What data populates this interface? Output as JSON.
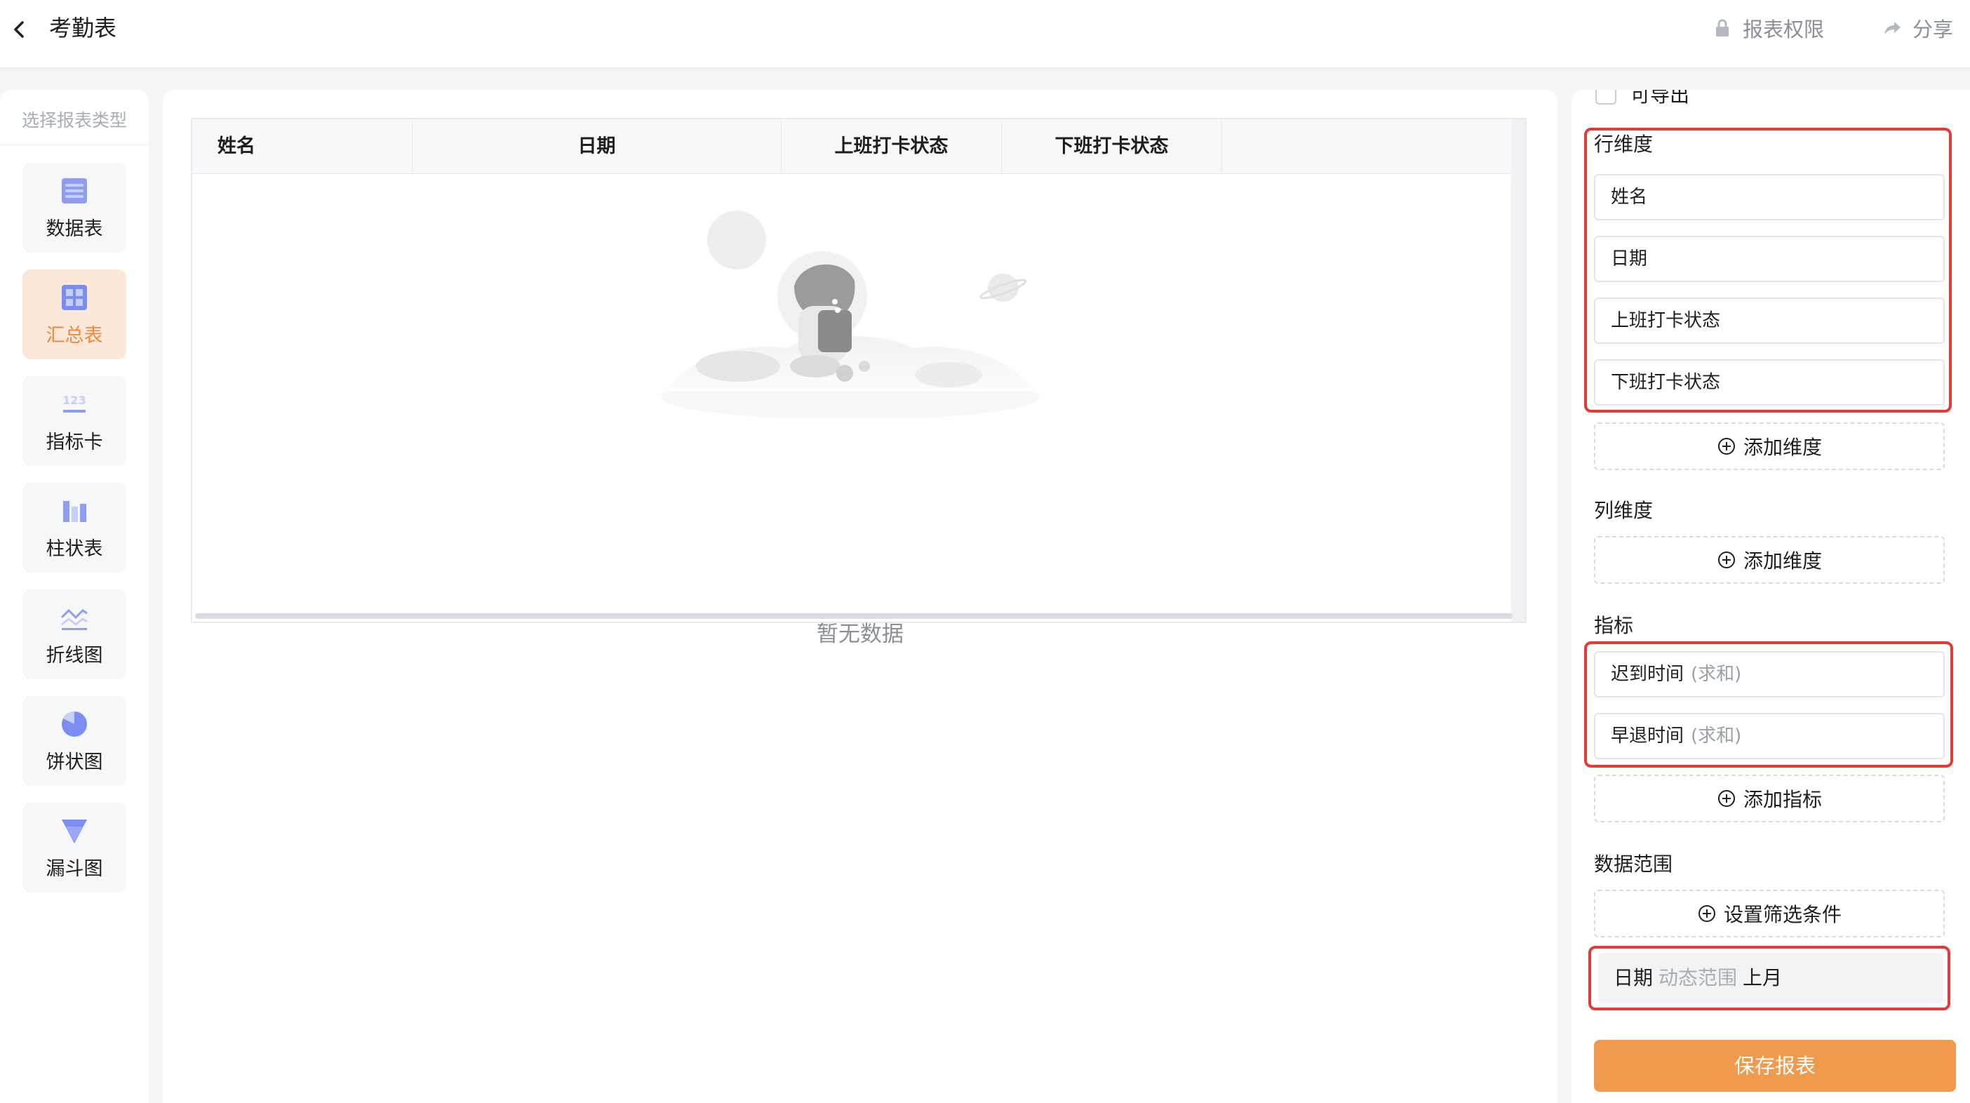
{
  "header": {
    "title": "考勤表",
    "permission_label": "报表权限",
    "share_label": "分享"
  },
  "sidebar": {
    "title": "选择报表类型",
    "items": [
      {
        "label": "数据表",
        "icon": "table-icon"
      },
      {
        "label": "汇总表",
        "icon": "summary-table-icon",
        "active": true
      },
      {
        "label": "指标卡",
        "icon": "metric-card-icon"
      },
      {
        "label": "柱状表",
        "icon": "bar-chart-icon"
      },
      {
        "label": "折线图",
        "icon": "line-chart-icon"
      },
      {
        "label": "饼状图",
        "icon": "pie-chart-icon"
      },
      {
        "label": "漏斗图",
        "icon": "funnel-chart-icon"
      }
    ]
  },
  "table": {
    "columns": [
      "姓名",
      "日期",
      "上班打卡状态",
      "下班打卡状态"
    ],
    "empty_text": "暂无数据"
  },
  "config": {
    "exportable_label": "可导出",
    "row_dimension": {
      "label": "行维度",
      "fields": [
        "姓名",
        "日期",
        "上班打卡状态",
        "下班打卡状态"
      ],
      "add_label": "添加维度"
    },
    "column_dimension": {
      "label": "列维度",
      "add_label": "添加维度"
    },
    "metrics": {
      "label": "指标",
      "fields": [
        {
          "name": "迟到时间",
          "agg": "(求和)"
        },
        {
          "name": "早退时间",
          "agg": "(求和)"
        }
      ],
      "add_label": "添加指标"
    },
    "data_range": {
      "label": "数据范围",
      "add_label": "设置筛选条件",
      "filter": {
        "field": "日期",
        "mode": "动态范围",
        "value": "上月"
      }
    },
    "save_label": "保存报表"
  },
  "colors": {
    "accent": "#ef9a4c",
    "active_bg": "#fce8da",
    "active_text": "#ef8a3b",
    "highlight": "#e53935",
    "icon_blue": "#7b8df0"
  }
}
